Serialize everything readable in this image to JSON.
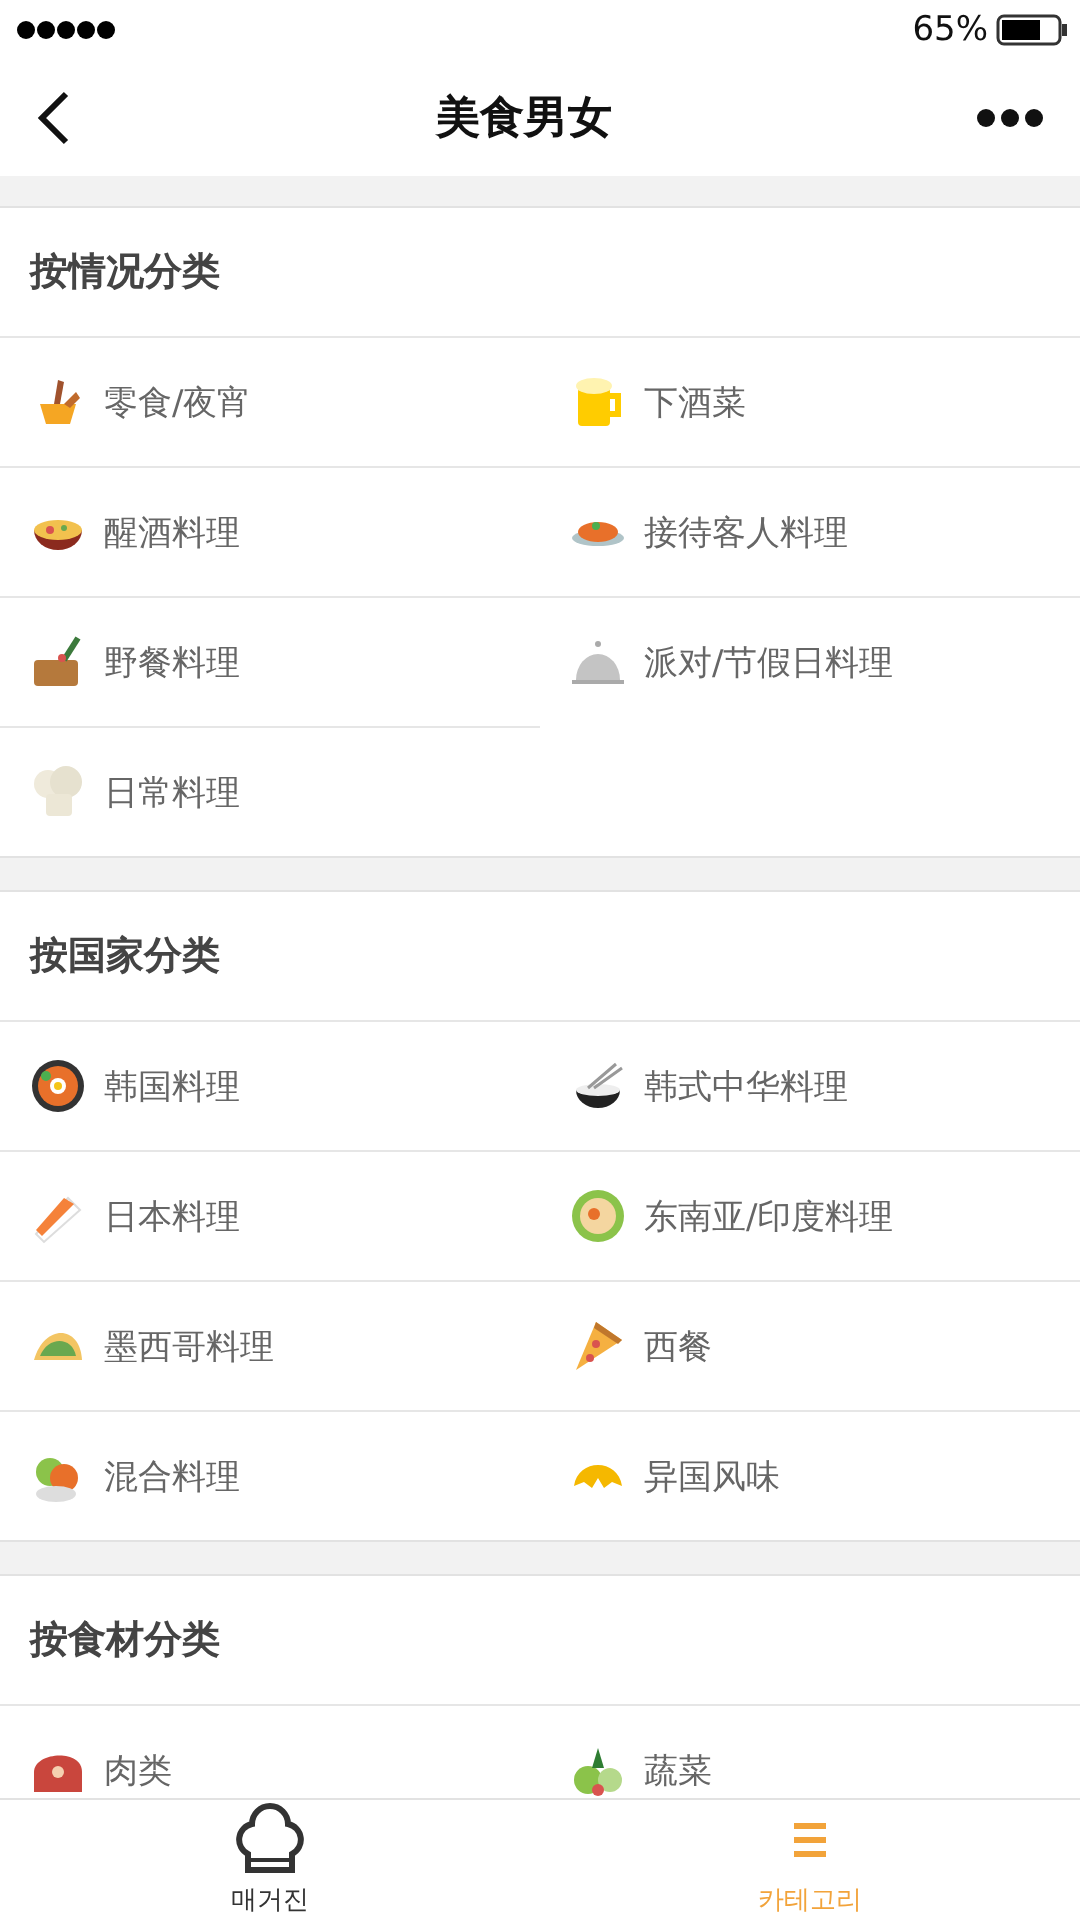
{
  "status_bar": {
    "battery": "65%"
  },
  "nav": {
    "title": "美食男女"
  },
  "sections": [
    {
      "title": "按情况分类",
      "items": [
        "零食/夜宵",
        "下酒菜",
        "醒酒料理",
        "接待客人料理",
        "野餐料理",
        "派对/节假日料理",
        "日常料理"
      ]
    },
    {
      "title": "按国家分类",
      "items": [
        "韩国料理",
        "韩式中华料理",
        "日本料理",
        "东南亚/印度料理",
        "墨西哥料理",
        "西餐",
        "混合料理",
        "异国风味"
      ]
    },
    {
      "title": "按食材分类",
      "items": [
        "肉类",
        "蔬菜"
      ]
    }
  ],
  "tab_bar": [
    {
      "label": "매거진",
      "selected": false
    },
    {
      "label": "카테고리",
      "selected": true
    }
  ]
}
